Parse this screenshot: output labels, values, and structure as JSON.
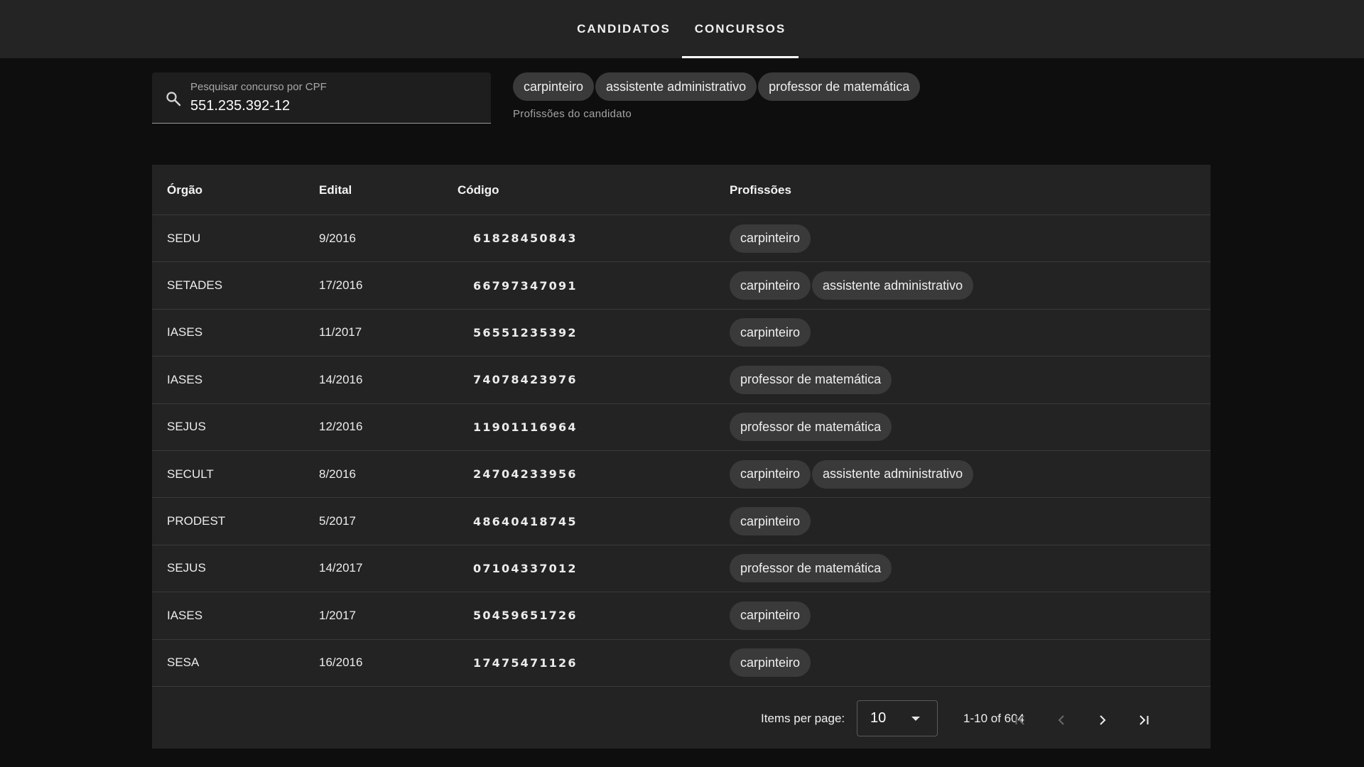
{
  "nav": {
    "tabs": [
      {
        "label": "CANDIDATOS",
        "active": false
      },
      {
        "label": "CONCURSOS",
        "active": true
      }
    ]
  },
  "search": {
    "label": "Pesquisar concurso por CPF",
    "value": "551.235.392-12",
    "icon": "search-icon"
  },
  "candidate": {
    "professions": [
      "carpinteiro",
      "assistente administrativo",
      "professor de matemática"
    ],
    "hint": "Profissões do candidato"
  },
  "table": {
    "headers": {
      "orgao": "Órgão",
      "edital": "Edital",
      "codigo": "Código",
      "profissoes": "Profissões"
    },
    "rows": [
      {
        "orgao": "SEDU",
        "edital": "9/2016",
        "codigo": "61828450843",
        "profissoes": [
          "carpinteiro"
        ]
      },
      {
        "orgao": "SETADES",
        "edital": "17/2016",
        "codigo": "66797347091",
        "profissoes": [
          "carpinteiro",
          "assistente administrativo"
        ]
      },
      {
        "orgao": "IASES",
        "edital": "11/2017",
        "codigo": "56551235392",
        "profissoes": [
          "carpinteiro"
        ]
      },
      {
        "orgao": "IASES",
        "edital": "14/2016",
        "codigo": "74078423976",
        "profissoes": [
          "professor de matemática"
        ]
      },
      {
        "orgao": "SEJUS",
        "edital": "12/2016",
        "codigo": "11901116964",
        "profissoes": [
          "professor de matemática"
        ]
      },
      {
        "orgao": "SECULT",
        "edital": "8/2016",
        "codigo": "24704233956",
        "profissoes": [
          "carpinteiro",
          "assistente administrativo"
        ]
      },
      {
        "orgao": "PRODEST",
        "edital": "5/2017",
        "codigo": "48640418745",
        "profissoes": [
          "carpinteiro"
        ]
      },
      {
        "orgao": "SEJUS",
        "edital": "14/2017",
        "codigo": "07104337012",
        "profissoes": [
          "professor de matemática"
        ]
      },
      {
        "orgao": "IASES",
        "edital": "1/2017",
        "codigo": "50459651726",
        "profissoes": [
          "carpinteiro"
        ]
      },
      {
        "orgao": "SESA",
        "edital": "16/2016",
        "codigo": "17475471126",
        "profissoes": [
          "carpinteiro"
        ]
      }
    ]
  },
  "paginator": {
    "items_per_page_label": "Items per page:",
    "items_per_page_value": "10",
    "range_label": "1-10 of 604",
    "buttons": {
      "first": {
        "icon": "first-page-icon",
        "enabled": false
      },
      "prev": {
        "icon": "chevron-left-icon",
        "enabled": false
      },
      "next": {
        "icon": "chevron-right-icon",
        "enabled": true
      },
      "last": {
        "icon": "last-page-icon",
        "enabled": true
      }
    }
  },
  "colors": {
    "background": "#0e0e0e",
    "toolbar": "#242424",
    "card": "#232323",
    "chip": "#3a3a3a",
    "divider": "#3a3a3a",
    "text": "#ffffff",
    "muted_text": "#a9a9a9",
    "disabled_icon": "#6a6a6a"
  }
}
